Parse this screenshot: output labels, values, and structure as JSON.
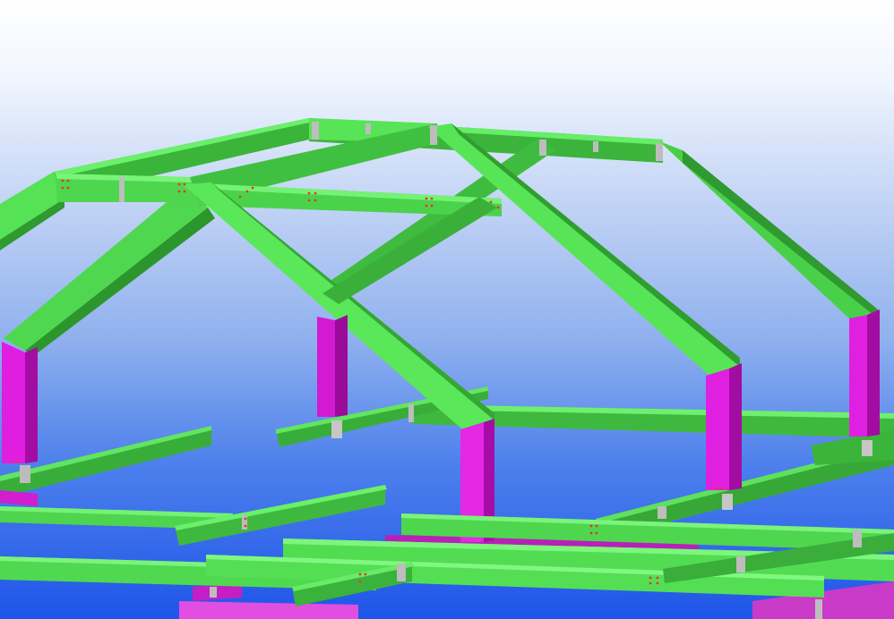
{
  "scene": {
    "kind": "3d-structural-steel-model-view",
    "background_gradient": [
      "#ffffff",
      "#dbe6fa",
      "#93b3ee",
      "#3f74ea",
      "#1f53e8"
    ],
    "colors": {
      "beam_face": "#5ae85a",
      "beam_side": "#38b238",
      "beam_dark": "#2e9630",
      "beam_edge": "#1f6e1f",
      "column_face": "#e11ee1",
      "column_side": "#a80ca8",
      "column_light": "#f060f0",
      "base_plate": "#c3c3c3",
      "bolt_dot": "#e8362c"
    },
    "members": [
      {
        "name": "portal-frame-1",
        "type": "portal-frame"
      },
      {
        "name": "portal-frame-2",
        "type": "portal-frame"
      },
      {
        "name": "portal-frame-3",
        "type": "portal-frame"
      },
      {
        "name": "ridge-purlin",
        "type": "beam"
      },
      {
        "name": "eave-purlin-front",
        "type": "beam"
      },
      {
        "name": "eave-purlin-back",
        "type": "beam"
      },
      {
        "name": "ground-beams",
        "type": "beam-grid"
      }
    ],
    "icons": [
      "none"
    ]
  }
}
